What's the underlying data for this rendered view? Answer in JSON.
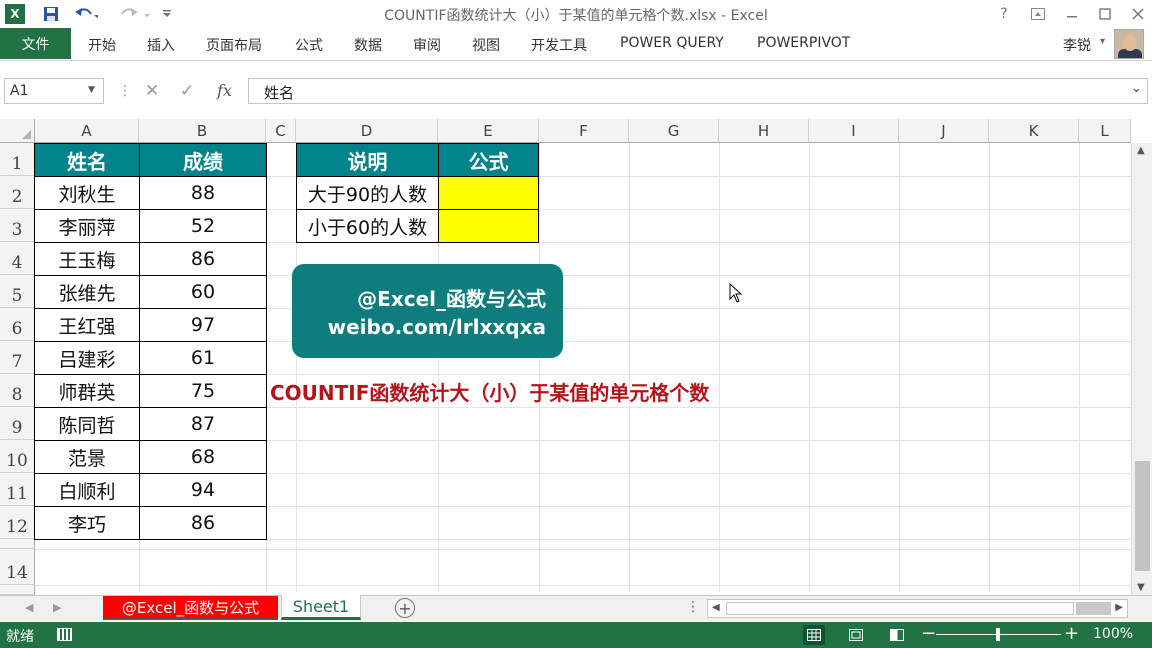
{
  "window": {
    "title": "COUNTIF函数统计大（小）于某值的单元格个数.xlsx - Excel",
    "help": "?",
    "app_logo": "X"
  },
  "ribbon": {
    "file_label": "文件",
    "tabs": [
      "开始",
      "插入",
      "页面布局",
      "公式",
      "数据",
      "审阅",
      "视图",
      "开发工具",
      "POWER QUERY",
      "POWERPIVOT"
    ],
    "user_name": "李锐"
  },
  "formula_bar": {
    "name_box": "A1",
    "fx": "fx",
    "content": "姓名"
  },
  "grid": {
    "columns": [
      "A",
      "B",
      "C",
      "D",
      "E",
      "F",
      "G",
      "H",
      "I",
      "J",
      "K",
      "L"
    ],
    "rows": [
      "1",
      "2",
      "3",
      "4",
      "5",
      "6",
      "7",
      "8",
      "9",
      "10",
      "11",
      "12",
      "14"
    ],
    "table_main": {
      "headers": [
        "姓名",
        "成绩"
      ],
      "rows": [
        [
          "刘秋生",
          "88"
        ],
        [
          "李丽萍",
          "52"
        ],
        [
          "王玉梅",
          "86"
        ],
        [
          "张维先",
          "60"
        ],
        [
          "王红强",
          "97"
        ],
        [
          "吕建彩",
          "61"
        ],
        [
          "师群英",
          "75"
        ],
        [
          "陈同哲",
          "87"
        ],
        [
          "范景",
          "68"
        ],
        [
          "白顺利",
          "94"
        ],
        [
          "李巧",
          "86"
        ]
      ]
    },
    "table_side": {
      "headers": [
        "说明",
        "公式"
      ],
      "rows": [
        [
          "大于90的人数",
          ""
        ],
        [
          "小于60的人数",
          ""
        ]
      ]
    },
    "badge": {
      "line1": "@Excel_函数与公式",
      "line2": "weibo.com/lrlxxqxa"
    },
    "caption": "COUNTIF函数统计大（小）于某值的单元格个数",
    "header_color": "#00838a",
    "highlight_color": "#ffff00",
    "badge_color": "#0f7c7e",
    "caption_color": "#b3151a"
  },
  "sheets": {
    "tabs": [
      "@Excel_函数与公式",
      "Sheet1"
    ],
    "active": "Sheet1",
    "first_tab_color": "#ff0000"
  },
  "status": {
    "ready": "就绪",
    "zoom": "100%",
    "accent": "#217346"
  }
}
